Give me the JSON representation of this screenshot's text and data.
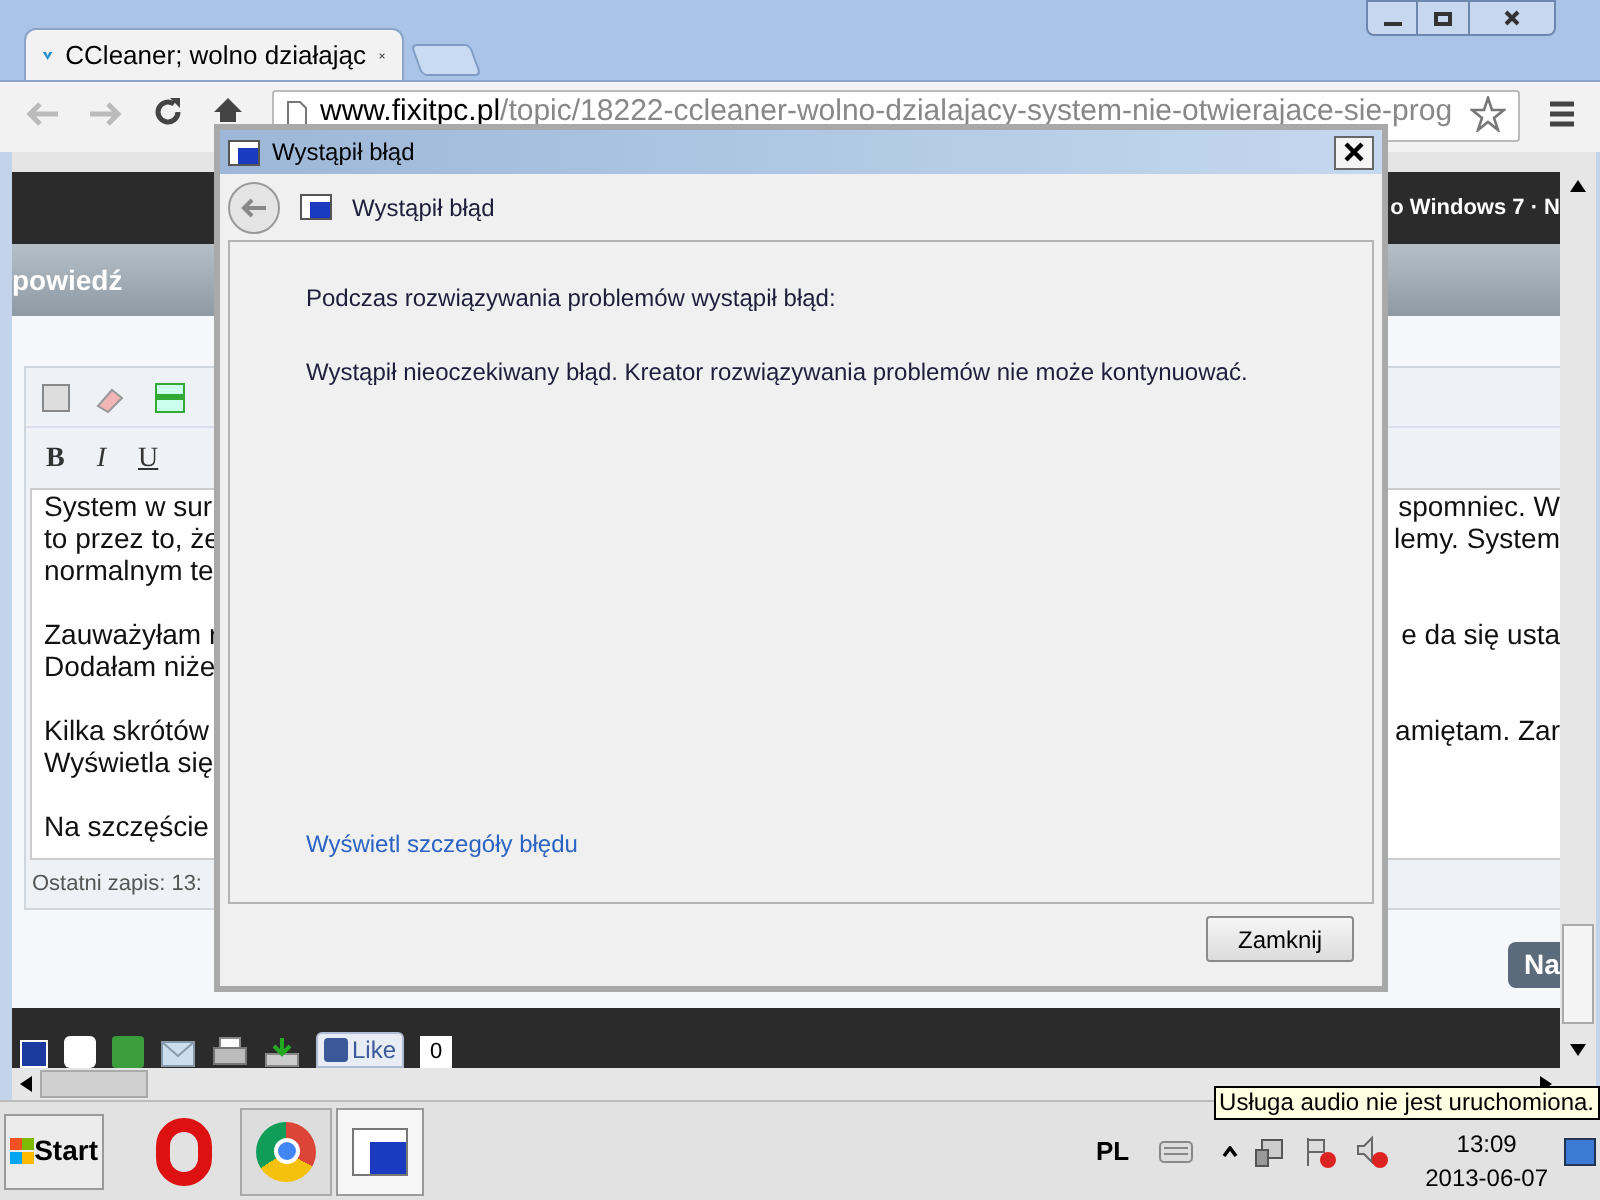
{
  "browser": {
    "tab": {
      "title": "CCleaner; wolno działając"
    },
    "url_host": "www.fixitpc.pl",
    "url_path": "/topic/18222-ccleaner-wolno-dzialajacy-system-nie-otwierajace-sie-prog",
    "nav_right_text": "o Windows 7 · N",
    "section_title": "powiedź",
    "editor": {
      "format_buttons": [
        "B",
        "I",
        "U"
      ],
      "paragraphs": [
        {
          "lines": [
            {
              "left": "System w sur",
              "right": "spomniec. W"
            },
            {
              "left": "to przez to, że",
              "right": "lemy. System"
            },
            {
              "left": "normalnym te"
            }
          ]
        },
        {
          "lines": [
            {
              "left": "Zauważyłam r",
              "right": "e da się usta"
            },
            {
              "left": "Dodałam niże"
            }
          ]
        },
        {
          "lines": [
            {
              "left": "Kilka skrótów",
              "right": "amiętam. Zar"
            },
            {
              "left": "Wyświetla się"
            }
          ]
        },
        {
          "lines": [
            {
              "left": "Na szczęście"
            }
          ]
        }
      ],
      "status": "Ostatni zapis: 13:"
    },
    "next_button": "Na",
    "like": {
      "label": "Like",
      "count": "0"
    }
  },
  "dialog": {
    "title": "Wystąpił błąd",
    "heading": "Wystąpił błąd",
    "intro": "Podczas rozwiązywania problemów wystąpił błąd:",
    "message": "Wystąpił nieoczekiwany błąd. Kreator rozwiązywania problemów nie może kontynuować.",
    "details_link": "Wyświetl szczegóły błędu",
    "close_button": "Zamknij"
  },
  "taskbar": {
    "start": "Start",
    "language": "PL",
    "time": "13:09",
    "date": "2013-06-07",
    "tooltip": "Usługa audio nie jest uruchomiona."
  }
}
